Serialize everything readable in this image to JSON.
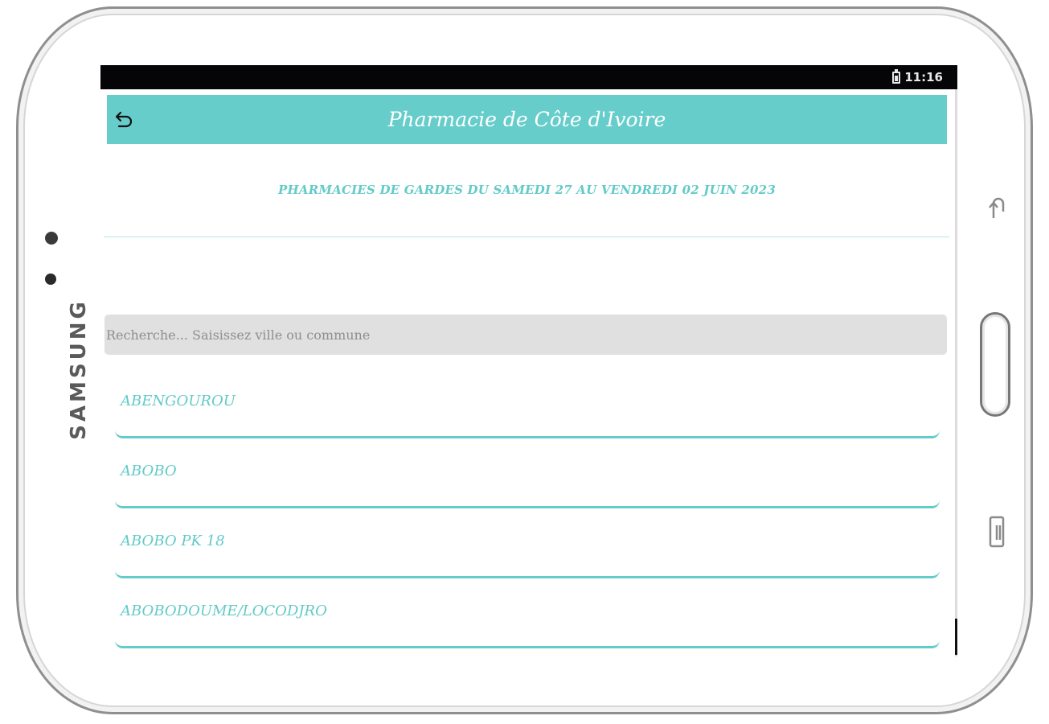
{
  "device": {
    "brand": "SAMSUNG"
  },
  "statusbar": {
    "time": "11:16",
    "battery_icon": "battery-icon"
  },
  "appbar": {
    "title": "Pharmacie de Côte d'Ivoire",
    "back_icon": "back-arrow-icon",
    "color": "#66cdcb"
  },
  "header": {
    "subtitle": "PHARMACIES DE GARDES DU SAMEDI 27 AU VENDREDI 02 JUIN 2023"
  },
  "search": {
    "placeholder": "Recherche... Saisissez ville ou commune",
    "value": ""
  },
  "list": {
    "items": [
      {
        "label": "ABENGOUROU"
      },
      {
        "label": "ABOBO"
      },
      {
        "label": "ABOBO PK 18"
      },
      {
        "label": "ABOBODOUME/LOCODJRO"
      }
    ]
  },
  "colors": {
    "accent": "#63cbc8",
    "search_bg": "#e0e0e0"
  }
}
